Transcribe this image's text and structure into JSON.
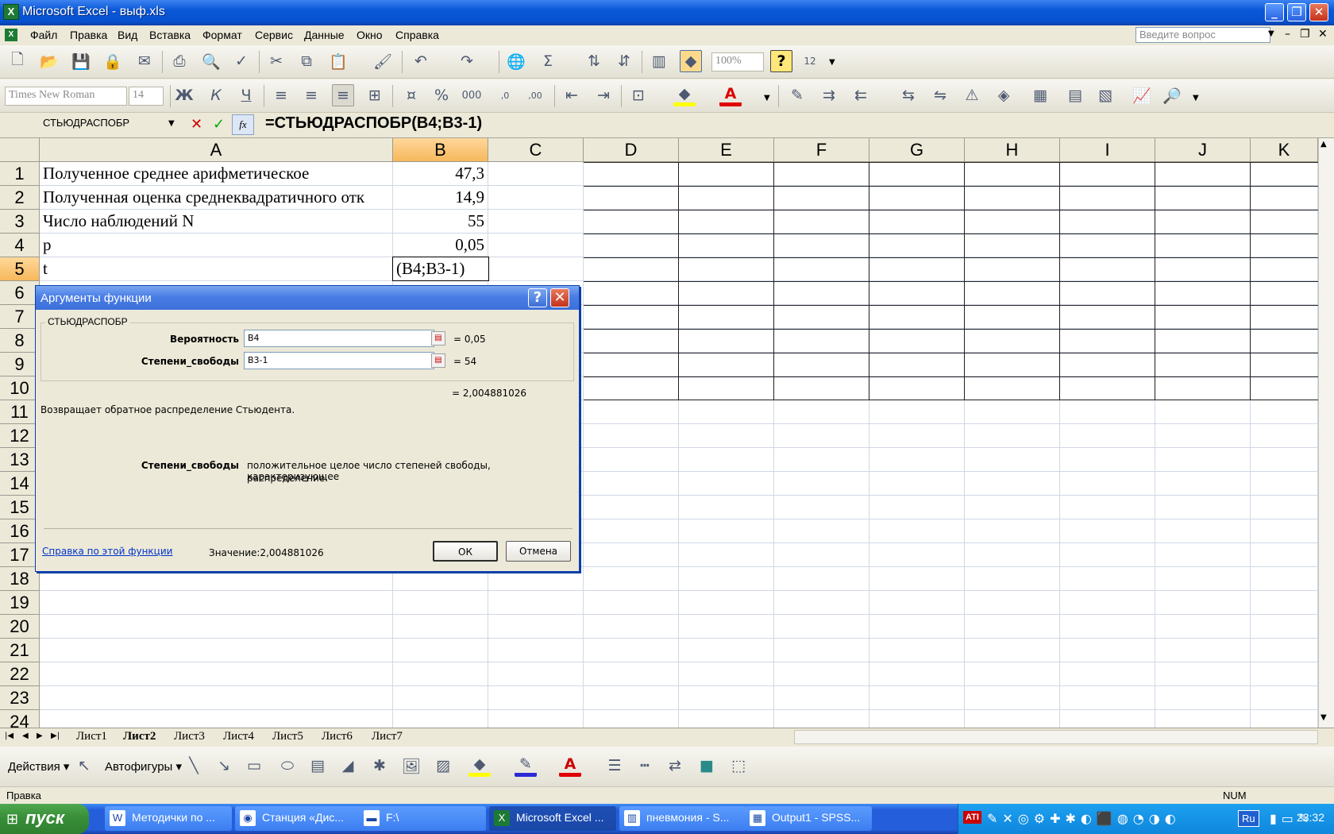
{
  "window": {
    "title": "Microsoft Excel - выф.xls"
  },
  "menu": {
    "items": [
      "Файл",
      "Правка",
      "Вид",
      "Вставка",
      "Формат",
      "Сервис",
      "Данные",
      "Окно",
      "Справка"
    ],
    "ask_placeholder": "Введите вопрос"
  },
  "toolbar": {
    "zoom": "100%",
    "font_name": "Times New Roman",
    "font_size": "14",
    "num_format_label": "12"
  },
  "formula_bar": {
    "name_box": "СТЬЮДРАСПОБР",
    "fx": "fx",
    "formula": "=СТЬЮДРАСПОБР(B4;B3-1)"
  },
  "grid": {
    "columns": [
      "A",
      "B",
      "C",
      "D",
      "E",
      "F",
      "G",
      "H",
      "I",
      "J",
      "K"
    ],
    "rows": [
      "1",
      "2",
      "3",
      "4",
      "5",
      "6",
      "7",
      "8",
      "9",
      "10",
      "11",
      "12",
      "13",
      "14",
      "15",
      "16",
      "17",
      "18",
      "19",
      "20",
      "21",
      "22",
      "23",
      "24"
    ],
    "cells": [
      {
        "a": "Полученное среднее арифметическое",
        "b": "47,3"
      },
      {
        "a": "Полученная оценка среднеквадратичного отк",
        "b": "14,9"
      },
      {
        "a": "Число наблюдений N",
        "b": "55"
      },
      {
        "a": "p",
        "b": "0,05"
      },
      {
        "a": "t",
        "b": "(B4;B3-1)"
      }
    ]
  },
  "dialog": {
    "title": "Аргументы функции",
    "function_name": "СТЬЮДРАСПОБР",
    "args": [
      {
        "label": "Вероятность",
        "value": "B4",
        "result": "= 0,05"
      },
      {
        "label": "Степени_свободы",
        "value": "B3-1",
        "result": "= 54"
      }
    ],
    "result": "= 2,004881026",
    "description": "Возвращает обратное распределение Стьюдента.",
    "arg_help_label": "Степени_свободы",
    "arg_help_text_1": "положительное целое число степеней свободы, характеризующее",
    "arg_help_text_2": "распределение.",
    "help_link": "Справка по этой функции",
    "value_text": "Значение:2,004881026",
    "ok": "ОК",
    "cancel": "Отмена"
  },
  "sheets": {
    "tabs": [
      "Лист1",
      "Лист2",
      "Лист3",
      "Лист4",
      "Лист5",
      "Лист6",
      "Лист7"
    ],
    "active": "Лист2"
  },
  "drawbar": {
    "actions": "Действия ▾",
    "autoshapes": "Автофигуры ▾"
  },
  "status": {
    "left": "Правка",
    "num": "NUM"
  },
  "taskbar": {
    "start": "пуск",
    "buttons": [
      "Методички по ...",
      "Станция «Дис...",
      "F:\\",
      "Microsoft Excel ...",
      "пневмония - S...",
      "Output1 - SPSS..."
    ],
    "lang": "Ru",
    "clock": "23:32"
  }
}
